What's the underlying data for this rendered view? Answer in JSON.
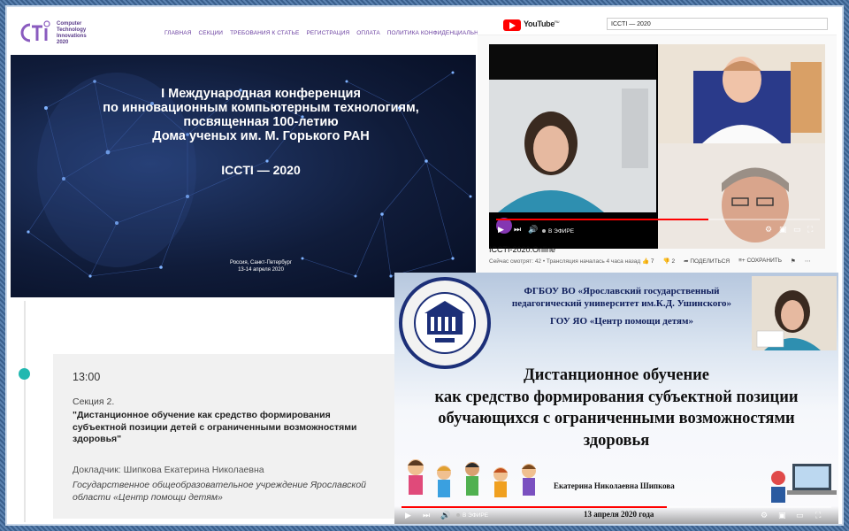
{
  "site": {
    "logo_lines": [
      "Computer",
      "Technology",
      "Innovations",
      "2020"
    ],
    "nav": [
      "ГЛАВНАЯ",
      "СЕКЦИИ",
      "ТРЕБОВАНИЯ К СТАТЬЕ",
      "РЕГИСТРАЦИЯ",
      "ОПЛАТА",
      "ПОЛИТИКА КОНФИДЕНЦИАЛЬНОСТИ"
    ],
    "hero_title_lines": [
      "I Международная конференция",
      "по инновационным компьютерным технологиям,",
      "посвященная 100-летию",
      "Дома ученых им. М. Горького РАН"
    ],
    "conference": "ICCTI — 2020",
    "place_lines": [
      "Россия, Санкт-Петербург",
      "13-14 апреля 2020"
    ]
  },
  "program": {
    "time": "13:00",
    "section": "Секция 2.",
    "title": "\"Дистанционное обучение как средство формирования субъектной позиции детей с ограниченными возможностями здоровья\"",
    "speaker": "Докладчик: Шипкова Екатерина Николаевна",
    "organization": "Государственное общеобразовательное учреждение Ярославской области «Центр помощи детям»"
  },
  "youtube": {
    "brand": "YouTube",
    "brand_sup": "RU",
    "search_value": "ICCTI — 2020",
    "live_label": "В ЭФИРЕ",
    "video_title": "ICCTI-2020.Online",
    "meta": "Сейчас смотрят: 42 • Трансляция началась 4 часа назад",
    "likes": "7",
    "dislikes": "2",
    "share": "ПОДЕЛИТЬСЯ",
    "save": "СОХРАНИТЬ"
  },
  "slide": {
    "header_lines": [
      "ФГБОУ ВО «Ярославский государственный",
      "педагогический университет им.К.Д. Ушинского»"
    ],
    "header_org": "ГОУ ЯО «Центр помощи детям»",
    "title_lines": [
      "Дистанционное обучение",
      "как средство формирования субъектной позиции",
      "обучающихся с ограниченными возможностями",
      "здоровья"
    ],
    "author": "Екатерина Николаевна Шипкова",
    "date": "13 апреля 2020 года",
    "live_label": "В ЭФИРЕ"
  }
}
